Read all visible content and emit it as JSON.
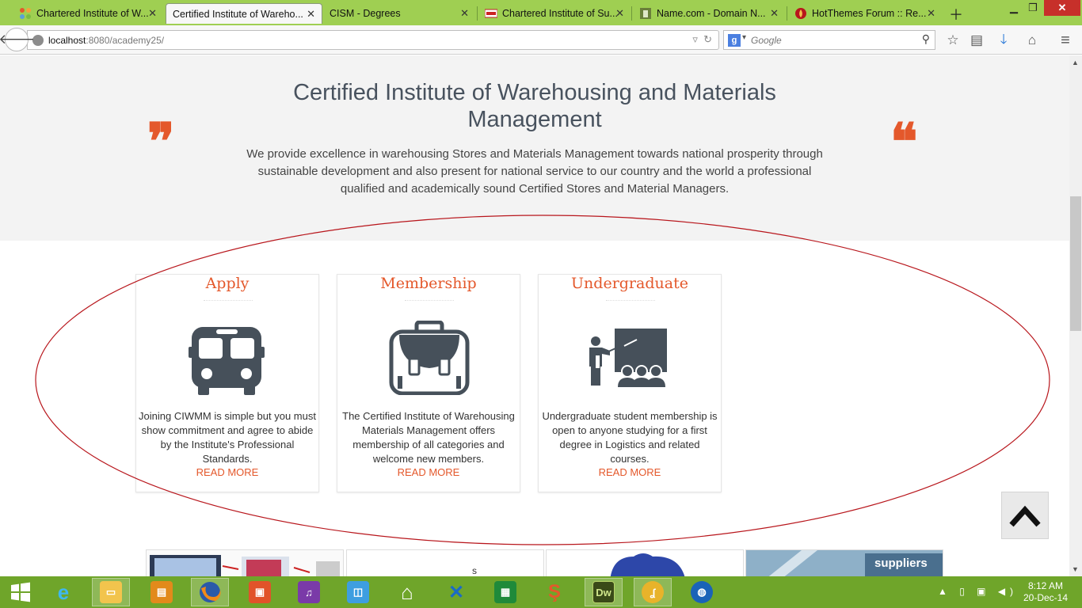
{
  "browser": {
    "tabs": [
      {
        "label": "Chartered Institute of W...",
        "icon": "joomla-icon"
      },
      {
        "label": "Certified Institute of Wareho...",
        "icon": "",
        "active": true
      },
      {
        "label": "CISM - Degrees",
        "icon": ""
      },
      {
        "label": "Chartered Institute of Su...",
        "icon": "cism-favicon-icon"
      },
      {
        "label": "Name.com - Domain N...",
        "icon": "namecom-favicon-icon"
      },
      {
        "label": "HotThemes Forum :: Re...",
        "icon": "hotthemes-favicon-icon"
      }
    ],
    "url_host": "localhost",
    "url_path": ":8080/academy25/",
    "search_placeholder": "Google",
    "search_engine_letter": "g"
  },
  "page": {
    "title": "Certified Institute of Warehousing and Materials Management",
    "intro": "We provide excellence in warehousing Stores and Materials Management towards national prosperity through sustainable development and also present for national service to our country and the world a professional qualified and academically sound Certified Stores and Material Managers.",
    "quote_open": "❞",
    "quote_close": "❝",
    "cards": [
      {
        "title": "Apply",
        "icon": "bus-icon",
        "text": "Joining CIWMM is simple but you must show commitment and agree to abide by the Institute's Professional Standards.",
        "link": "READ MORE"
      },
      {
        "title": "Membership",
        "icon": "briefcase-icon",
        "text": "The Certified Institute of Warehousing Materials Management offers membership of all categories and welcome new members.",
        "link": "READ MORE"
      },
      {
        "title": "Undergraduate",
        "icon": "teacher-board-icon",
        "text": "Undergraduate student membership is open to anyone studying for a first degree in Logistics and related courses.",
        "link": "READ MORE"
      }
    ],
    "strip_suppliers_label": "suppliers",
    "annotation_color": "#b8161c",
    "accent_color": "#e4582b"
  },
  "taskbar": {
    "apps": [
      "internet-explorer-icon",
      "file-explorer-icon",
      "notes-icon",
      "firefox-icon",
      "photos-icon",
      "media-icon",
      "store-bag-icon",
      "home-icon",
      "network-icon",
      "excel-icon",
      "sketch-icon",
      "dreamweaver-icon",
      "fireworks-icon",
      "globe-icon"
    ],
    "dw_label": "Dw",
    "time": "8:12 AM",
    "date": "20-Dec-14"
  }
}
